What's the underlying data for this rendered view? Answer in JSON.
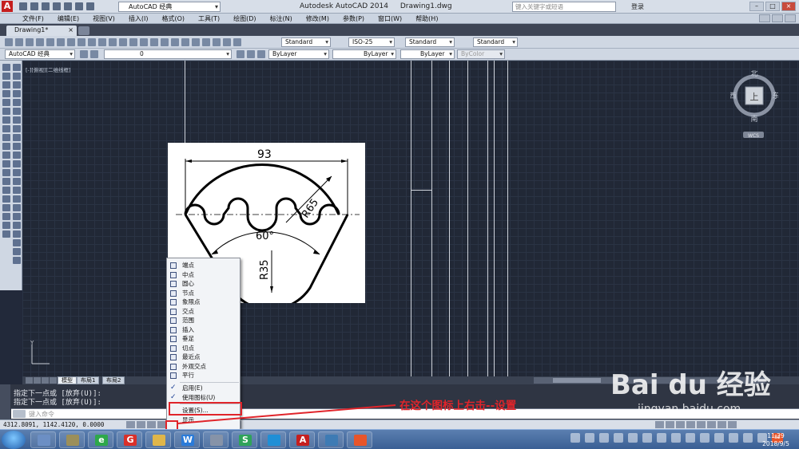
{
  "titlebar": {
    "workspace": "AutoCAD 经典",
    "app_title": "Autodesk AutoCAD 2014",
    "doc_title": "Drawing1.dwg",
    "search_placeholder": "键入关键字或短语",
    "login": "登录"
  },
  "menu": [
    "文件(F)",
    "编辑(E)",
    "视图(V)",
    "插入(I)",
    "格式(O)",
    "工具(T)",
    "绘图(D)",
    "标注(N)",
    "修改(M)",
    "参数(P)",
    "窗口(W)",
    "帮助(H)"
  ],
  "doc_tab": "Drawing1*",
  "toolbar1": {
    "text_style": "Standard",
    "dim_style": "ISO-25",
    "table_style": "Standard",
    "mleader_style": "Standard"
  },
  "toolbar2": {
    "workspace": "AutoCAD 经典",
    "layer": "0",
    "color": "ByLayer",
    "linetype": "ByLayer",
    "lineweight": "ByLayer",
    "plotstyle": "ByColor"
  },
  "viewport_label": "[-][俯视][二维线框]",
  "drawing": {
    "dim_width": "93",
    "dim_radius_large": "R65",
    "dim_angle": "60°",
    "dim_radius_small": "R35"
  },
  "viewcube": {
    "north": "北",
    "south": "南",
    "east": "东",
    "west": "西",
    "face": "上",
    "wcs": "WCS"
  },
  "ucs": {
    "y_label": "Y"
  },
  "layout_tabs": [
    "模型",
    "布局1",
    "布局2"
  ],
  "command_history": [
    "指定下一点或 [放弃(U)]:",
    "指定下一点或 [放弃(U)]:"
  ],
  "command_placeholder": "键入命令",
  "coordinates": "4312.8091, 1142.4120, 0.0000",
  "context_menu": {
    "snap_items": [
      "端点",
      "中点",
      "圆心",
      "节点",
      "象限点",
      "交点",
      "范围",
      "插入",
      "垂足",
      "切点",
      "最近点",
      "外观交点",
      "平行"
    ],
    "enable": "启用(E)",
    "use_icons": "使用图标(U)",
    "settings": "设置(S)...",
    "display": "显示"
  },
  "annotation": "在这个图标上右击--设置",
  "watermark": {
    "main": "Bai du 经验",
    "sub": "jingyan.baidu.com"
  },
  "taskbar": {
    "time": "11:29",
    "date": "2018/9/5",
    "badge": "82"
  }
}
